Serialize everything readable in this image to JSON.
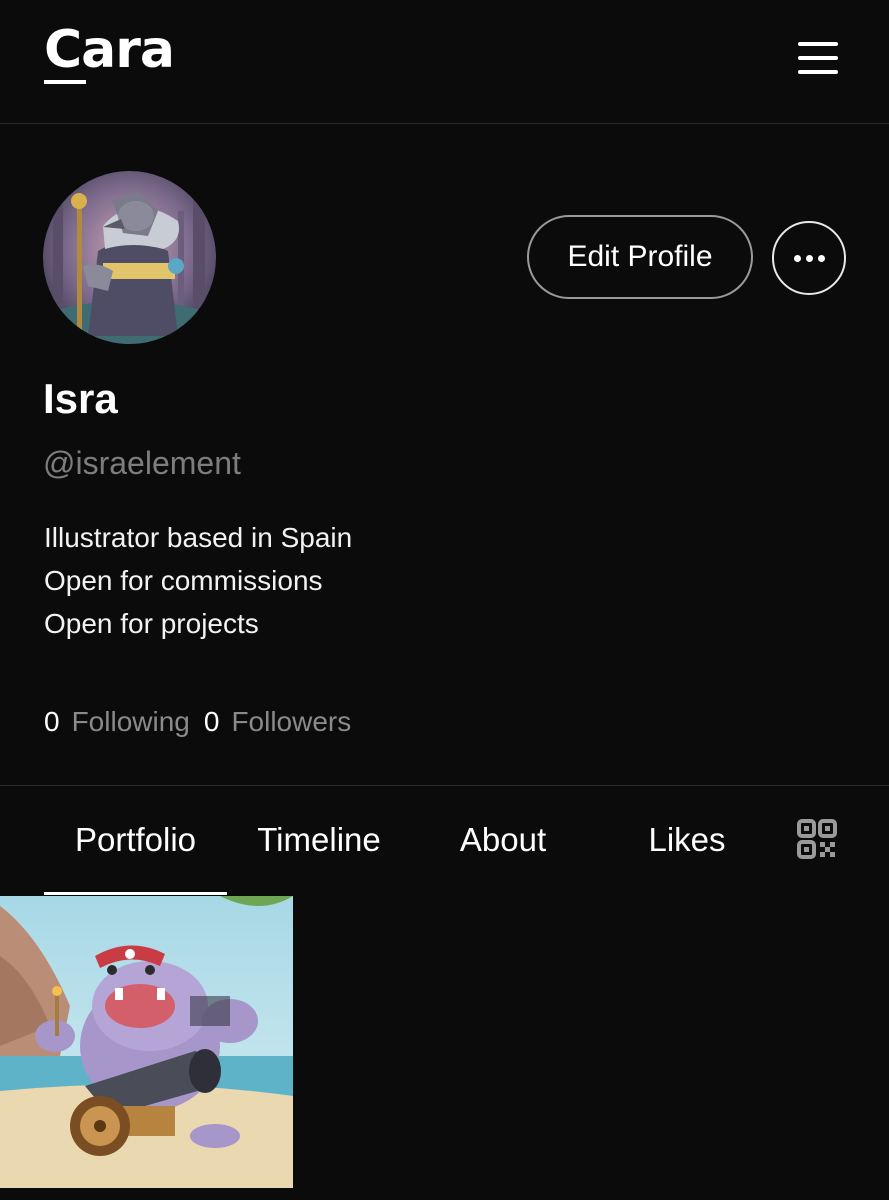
{
  "header": {
    "logo_text": "Cara",
    "menu_icon": "hamburger-menu-icon"
  },
  "profile": {
    "avatar_alt": "wolf-wizard-avatar",
    "edit_button_label": "Edit Profile",
    "more_icon": "more-horizontal-icon",
    "display_name": "Isra",
    "username": "@israelement",
    "bio": [
      "Illustrator based in Spain",
      "Open for commissions",
      "Open for projects"
    ],
    "stats": {
      "following_count": "0",
      "following_label": "Following",
      "followers_count": "0",
      "followers_label": "Followers"
    }
  },
  "tabs": {
    "items": [
      {
        "label": "Portfolio",
        "active": true
      },
      {
        "label": "Timeline",
        "active": false
      },
      {
        "label": "About",
        "active": false
      },
      {
        "label": "Likes",
        "active": false
      }
    ],
    "qr_icon": "qr-code-icon"
  },
  "portfolio": {
    "items": [
      {
        "title": "hippo-pirate-cannon-artwork"
      }
    ]
  },
  "colors": {
    "background": "#0b0b0b",
    "text_primary": "#ffffff",
    "text_muted": "#7d7d7d",
    "divider": "#2a2a2a"
  }
}
